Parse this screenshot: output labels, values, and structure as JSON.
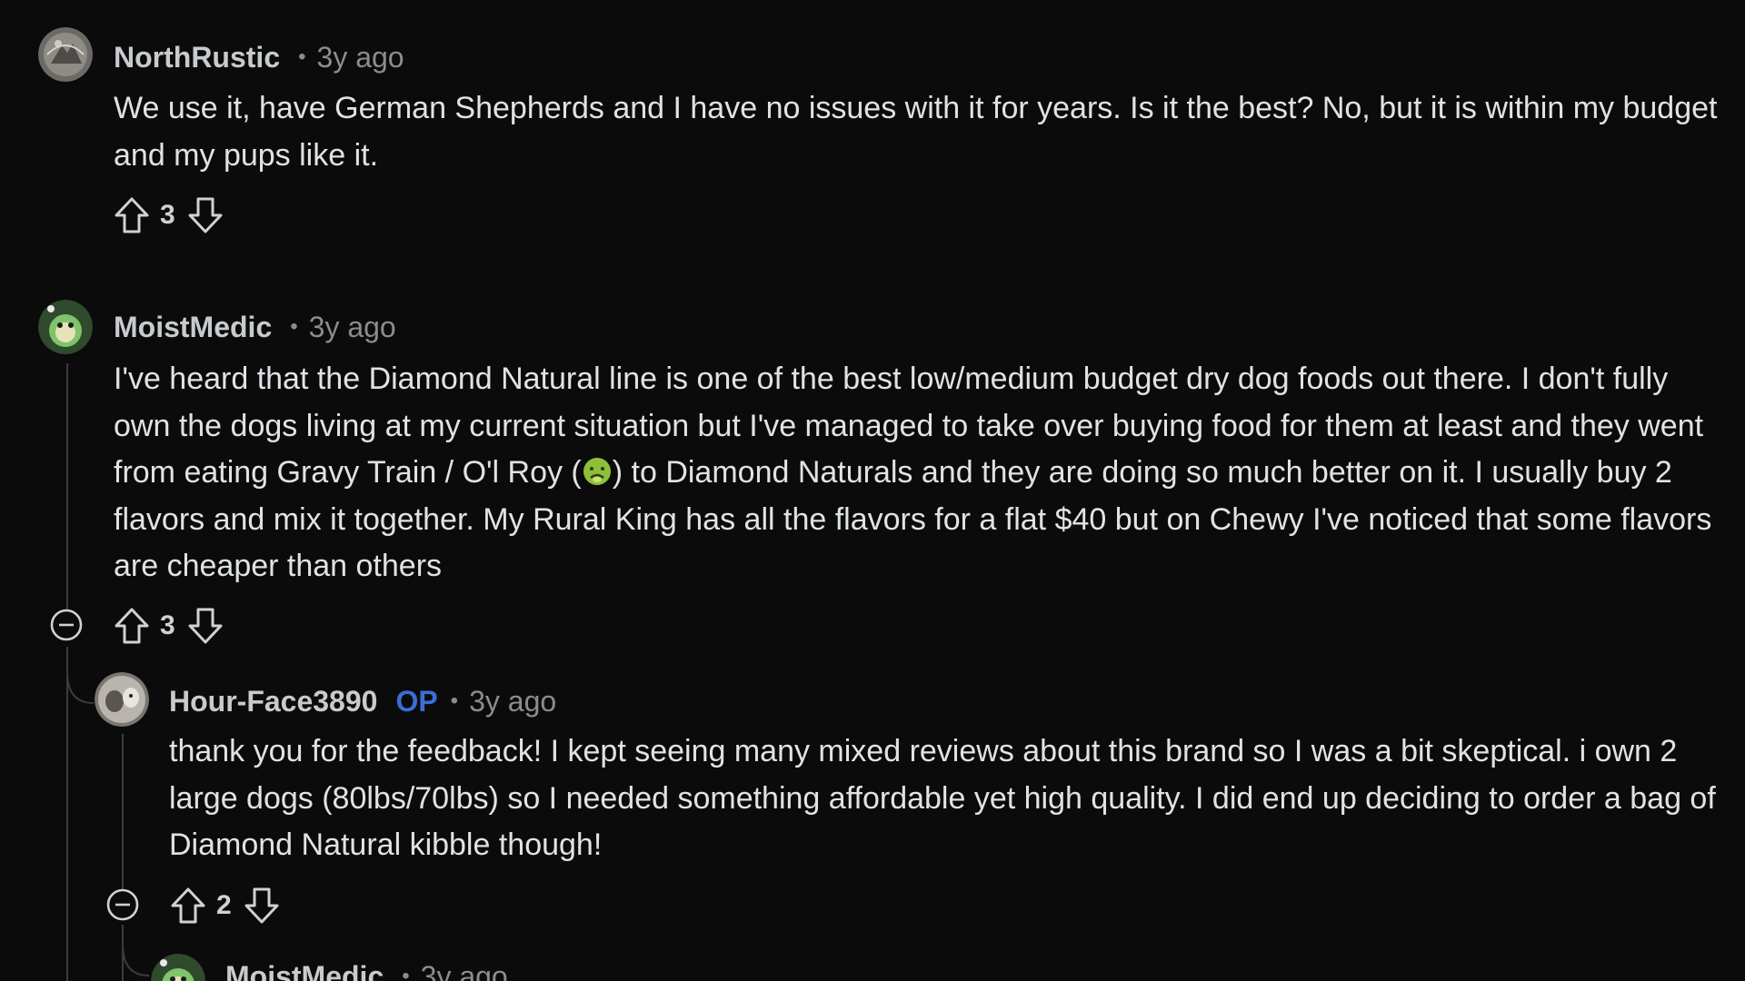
{
  "comments": [
    {
      "username": "NorthRustic",
      "separator": "•",
      "time": "3y ago",
      "body": "We use it, have German Shepherds and I have no issues with it for years. Is it the best? No, but it is within my budget and my pups like it.",
      "score": "3"
    },
    {
      "username": "MoistMedic",
      "separator": "•",
      "time": "3y ago",
      "body_part1": "I've heard that the Diamond Natural line is one of the best low/medium budget dry dog foods out there. I don't fully own the dogs living at my current situation but I've managed to take over buying food for them at least and they went from eating Gravy Train / O'l Roy (",
      "body_emoji": "nauseated-face-emoji",
      "body_part2": ") to Diamond Naturals and they are doing so much better on it. I usually buy 2 flavors and mix it together. My Rural King has all the flavors for a flat $40 but on Chewy I've noticed that some flavors are cheaper than others",
      "score": "3"
    },
    {
      "username": "Hour-Face3890",
      "op_badge": "OP",
      "separator": "•",
      "time": "3y ago",
      "body": "thank you for the feedback! I kept seeing many mixed reviews about this brand so I was a bit skeptical. i own 2 large dogs (80lbs/70lbs) so I needed something affordable yet high quality. I did end up deciding to order a bag of Diamond Natural kibble though!",
      "score": "2"
    },
    {
      "username": "MoistMedic",
      "separator": "•",
      "time": "3y ago"
    }
  ],
  "colors": {
    "background": "#0b0b0b",
    "username": "#c8cbcd",
    "op_badge": "#3a6ed6",
    "muted": "#8a8d8f",
    "body_text": "#e0e3e5"
  }
}
